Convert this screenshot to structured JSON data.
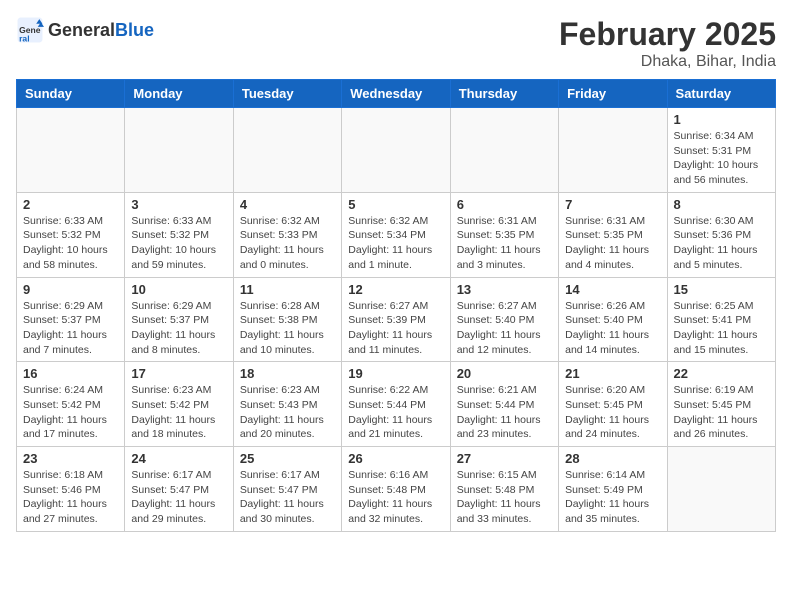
{
  "header": {
    "logo_general": "General",
    "logo_blue": "Blue",
    "month_year": "February 2025",
    "location": "Dhaka, Bihar, India"
  },
  "days_of_week": [
    "Sunday",
    "Monday",
    "Tuesday",
    "Wednesday",
    "Thursday",
    "Friday",
    "Saturday"
  ],
  "weeks": [
    [
      {
        "num": "",
        "info": ""
      },
      {
        "num": "",
        "info": ""
      },
      {
        "num": "",
        "info": ""
      },
      {
        "num": "",
        "info": ""
      },
      {
        "num": "",
        "info": ""
      },
      {
        "num": "",
        "info": ""
      },
      {
        "num": "1",
        "info": "Sunrise: 6:34 AM\nSunset: 5:31 PM\nDaylight: 10 hours and 56 minutes."
      }
    ],
    [
      {
        "num": "2",
        "info": "Sunrise: 6:33 AM\nSunset: 5:32 PM\nDaylight: 10 hours and 58 minutes."
      },
      {
        "num": "3",
        "info": "Sunrise: 6:33 AM\nSunset: 5:32 PM\nDaylight: 10 hours and 59 minutes."
      },
      {
        "num": "4",
        "info": "Sunrise: 6:32 AM\nSunset: 5:33 PM\nDaylight: 11 hours and 0 minutes."
      },
      {
        "num": "5",
        "info": "Sunrise: 6:32 AM\nSunset: 5:34 PM\nDaylight: 11 hours and 1 minute."
      },
      {
        "num": "6",
        "info": "Sunrise: 6:31 AM\nSunset: 5:35 PM\nDaylight: 11 hours and 3 minutes."
      },
      {
        "num": "7",
        "info": "Sunrise: 6:31 AM\nSunset: 5:35 PM\nDaylight: 11 hours and 4 minutes."
      },
      {
        "num": "8",
        "info": "Sunrise: 6:30 AM\nSunset: 5:36 PM\nDaylight: 11 hours and 5 minutes."
      }
    ],
    [
      {
        "num": "9",
        "info": "Sunrise: 6:29 AM\nSunset: 5:37 PM\nDaylight: 11 hours and 7 minutes."
      },
      {
        "num": "10",
        "info": "Sunrise: 6:29 AM\nSunset: 5:37 PM\nDaylight: 11 hours and 8 minutes."
      },
      {
        "num": "11",
        "info": "Sunrise: 6:28 AM\nSunset: 5:38 PM\nDaylight: 11 hours and 10 minutes."
      },
      {
        "num": "12",
        "info": "Sunrise: 6:27 AM\nSunset: 5:39 PM\nDaylight: 11 hours and 11 minutes."
      },
      {
        "num": "13",
        "info": "Sunrise: 6:27 AM\nSunset: 5:40 PM\nDaylight: 11 hours and 12 minutes."
      },
      {
        "num": "14",
        "info": "Sunrise: 6:26 AM\nSunset: 5:40 PM\nDaylight: 11 hours and 14 minutes."
      },
      {
        "num": "15",
        "info": "Sunrise: 6:25 AM\nSunset: 5:41 PM\nDaylight: 11 hours and 15 minutes."
      }
    ],
    [
      {
        "num": "16",
        "info": "Sunrise: 6:24 AM\nSunset: 5:42 PM\nDaylight: 11 hours and 17 minutes."
      },
      {
        "num": "17",
        "info": "Sunrise: 6:23 AM\nSunset: 5:42 PM\nDaylight: 11 hours and 18 minutes."
      },
      {
        "num": "18",
        "info": "Sunrise: 6:23 AM\nSunset: 5:43 PM\nDaylight: 11 hours and 20 minutes."
      },
      {
        "num": "19",
        "info": "Sunrise: 6:22 AM\nSunset: 5:44 PM\nDaylight: 11 hours and 21 minutes."
      },
      {
        "num": "20",
        "info": "Sunrise: 6:21 AM\nSunset: 5:44 PM\nDaylight: 11 hours and 23 minutes."
      },
      {
        "num": "21",
        "info": "Sunrise: 6:20 AM\nSunset: 5:45 PM\nDaylight: 11 hours and 24 minutes."
      },
      {
        "num": "22",
        "info": "Sunrise: 6:19 AM\nSunset: 5:45 PM\nDaylight: 11 hours and 26 minutes."
      }
    ],
    [
      {
        "num": "23",
        "info": "Sunrise: 6:18 AM\nSunset: 5:46 PM\nDaylight: 11 hours and 27 minutes."
      },
      {
        "num": "24",
        "info": "Sunrise: 6:17 AM\nSunset: 5:47 PM\nDaylight: 11 hours and 29 minutes."
      },
      {
        "num": "25",
        "info": "Sunrise: 6:17 AM\nSunset: 5:47 PM\nDaylight: 11 hours and 30 minutes."
      },
      {
        "num": "26",
        "info": "Sunrise: 6:16 AM\nSunset: 5:48 PM\nDaylight: 11 hours and 32 minutes."
      },
      {
        "num": "27",
        "info": "Sunrise: 6:15 AM\nSunset: 5:48 PM\nDaylight: 11 hours and 33 minutes."
      },
      {
        "num": "28",
        "info": "Sunrise: 6:14 AM\nSunset: 5:49 PM\nDaylight: 11 hours and 35 minutes."
      },
      {
        "num": "",
        "info": ""
      }
    ]
  ]
}
